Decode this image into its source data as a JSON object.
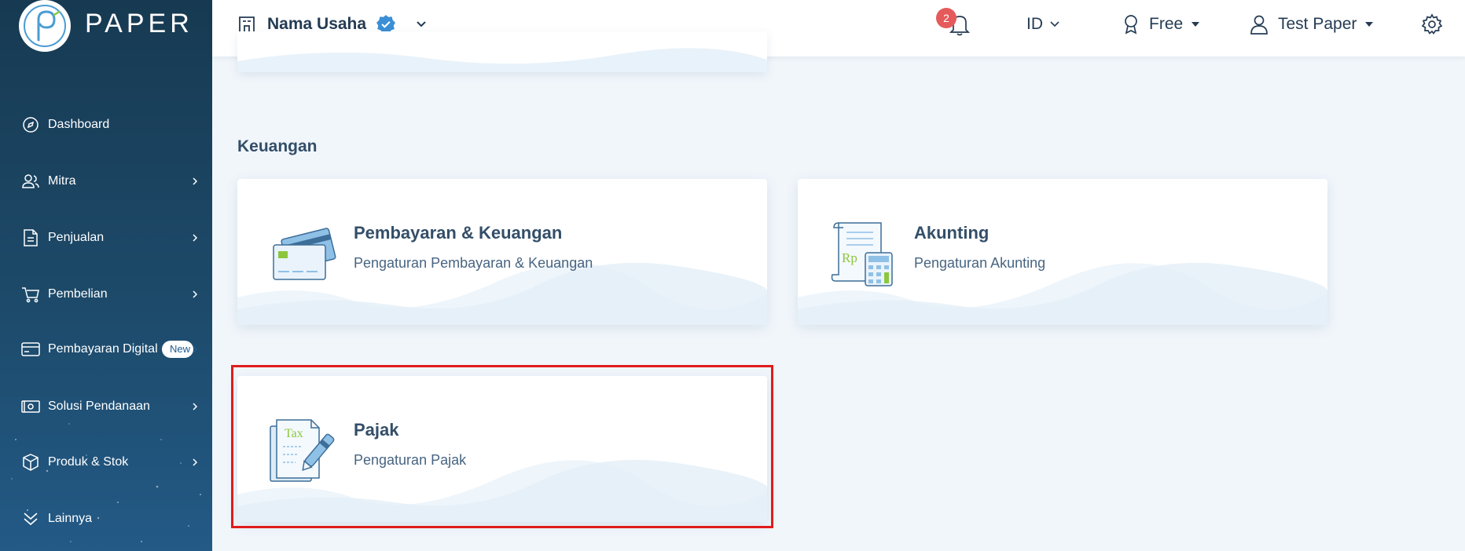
{
  "app": {
    "logo_text": "PAPER"
  },
  "sidebar": {
    "items": [
      {
        "label": "Dashboard",
        "icon": "compass-icon",
        "has_chevron": false
      },
      {
        "label": "Mitra",
        "icon": "users-icon",
        "has_chevron": true
      },
      {
        "label": "Penjualan",
        "icon": "document-icon",
        "has_chevron": true
      },
      {
        "label": "Pembelian",
        "icon": "cart-icon",
        "has_chevron": true
      },
      {
        "label": "Pembayaran Digital",
        "icon": "card-icon",
        "has_chevron": true,
        "badge": "New"
      },
      {
        "label": "Solusi Pendanaan",
        "icon": "money-icon",
        "has_chevron": true
      },
      {
        "label": "Produk & Stok",
        "icon": "box-icon",
        "has_chevron": true
      },
      {
        "label": "Lainnya",
        "icon": "double-chevron-down-icon",
        "has_chevron": false
      }
    ]
  },
  "header": {
    "business_name": "Nama Usaha",
    "notification_count": "2",
    "language": "ID",
    "plan": "Free",
    "user": "Test Paper"
  },
  "main": {
    "section_title": "Keuangan",
    "cards": [
      {
        "title": "Pembayaran & Keuangan",
        "subtitle": "Pengaturan Pembayaran & Keuangan",
        "icon": "credit-card-icon"
      },
      {
        "title": "Akunting",
        "subtitle": "Pengaturan Akunting",
        "icon": "ledger-calculator-icon",
        "icon_text": "Rp"
      },
      {
        "title": "Pajak",
        "subtitle": "Pengaturan Pajak",
        "icon": "tax-document-pen-icon",
        "icon_text": "Tax"
      }
    ]
  },
  "colors": {
    "sidebar_top": "#173a52",
    "sidebar_bottom": "#235a86",
    "highlight": "#e01c1c",
    "verified": "#3b8fd6",
    "notification": "#e55a5a"
  }
}
